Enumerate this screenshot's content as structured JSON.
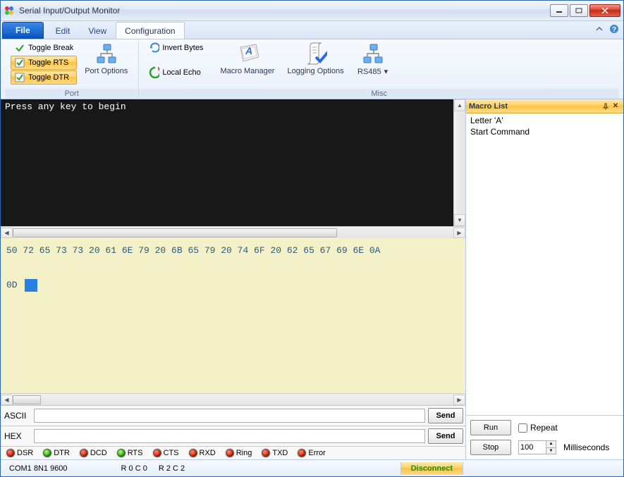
{
  "window": {
    "title": "Serial Input/Output Monitor"
  },
  "tabs": {
    "file": "File",
    "edit": "Edit",
    "view": "View",
    "configuration": "Configuration"
  },
  "ribbon": {
    "port": {
      "label": "Port",
      "toggle_break": "Toggle Break",
      "toggle_rts": "Toggle RTS",
      "toggle_dtr": "Toggle DTR",
      "port_options": "Port Options"
    },
    "misc": {
      "label": "Misc",
      "invert_bytes": "Invert Bytes",
      "local_echo": "Local Echo",
      "macro_manager": "Macro Manager",
      "logging_options": "Logging Options",
      "rs485": "RS485"
    }
  },
  "terminal_text": "Press any key to begin",
  "hex_line1": "50 72 65 73 73 20 61 6E 79 20 6B 65 79 20 74 6F 20 62 65 67 69 6E 0A",
  "hex_line2_prefix": "0D ",
  "send": {
    "ascii_label": "ASCII",
    "hex_label": "HEX",
    "button": "Send"
  },
  "leds": {
    "dsr": "DSR",
    "dtr": "DTR",
    "dcd": "DCD",
    "rts": "RTS",
    "cts": "CTS",
    "rxd": "RXD",
    "ring": "Ring",
    "txd": "TXD",
    "error": "Error"
  },
  "status": {
    "port": "COM1 8N1 9600",
    "cursor1": "R 0 C 0",
    "cursor2": "R 2 C 2",
    "disconnect": "Disconnect"
  },
  "macro": {
    "panel_title": "Macro List",
    "items": [
      "Letter 'A'",
      "Start Command"
    ],
    "run": "Run",
    "stop": "Stop",
    "repeat_label": "Repeat",
    "interval": "100",
    "interval_unit": "Milliseconds"
  }
}
